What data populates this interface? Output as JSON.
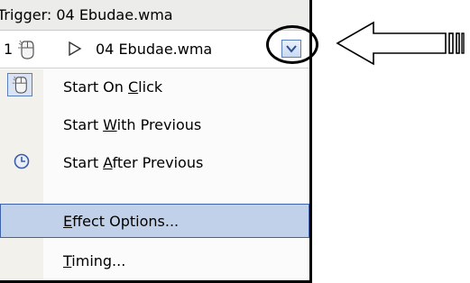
{
  "trigger": {
    "label": "Trigger: 04 Ebudae.wma"
  },
  "effect_row": {
    "index": "1",
    "filename": "04 Ebudae.wma",
    "icons": [
      "mouse-click-icon",
      "play-icon",
      "dropdown-arrow-icon"
    ]
  },
  "menu": {
    "items": [
      {
        "pre": "Start On ",
        "accel": "C",
        "post": "lick",
        "icon": "mouse-click-icon",
        "checked": true
      },
      {
        "pre": "Start ",
        "accel": "W",
        "post": "ith Previous",
        "icon": "",
        "checked": false
      },
      {
        "pre": "Start ",
        "accel": "A",
        "post": "fter Previous",
        "icon": "clock-icon",
        "checked": false
      },
      {
        "pre": "",
        "accel": "E",
        "post": "ffect Options...",
        "icon": "",
        "checked": false,
        "selected": true
      },
      {
        "pre": "",
        "accel": "T",
        "post": "iming...",
        "icon": "",
        "checked": false
      }
    ]
  },
  "annotation": {
    "highlight": "circle",
    "pointer": "hollow-left-arrow"
  },
  "colors": {
    "selected_bg": "#c2d1ea",
    "selected_border": "#3f63a8",
    "gutter": "#f2f1ec",
    "trigger_bg": "#ececea"
  }
}
